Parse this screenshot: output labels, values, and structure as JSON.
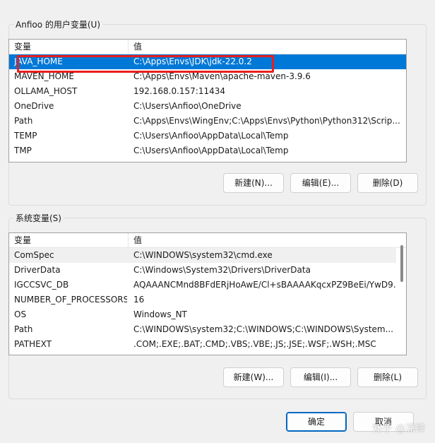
{
  "user_vars": {
    "title": "Anfioo 的用户变量(U)",
    "col_variable": "变量",
    "col_value": "值",
    "rows": [
      {
        "name": "JAVA_HOME",
        "value": "C:\\Apps\\Envs\\JDK\\jdk-22.0.2"
      },
      {
        "name": "MAVEN_HOME",
        "value": "C:\\Apps\\Envs\\Maven\\apache-maven-3.9.6"
      },
      {
        "name": "OLLAMA_HOST",
        "value": "192.168.0.157:11434"
      },
      {
        "name": "OneDrive",
        "value": "C:\\Users\\Anfioo\\OneDrive"
      },
      {
        "name": "Path",
        "value": "C:\\Apps\\Envs\\WingEnv;C:\\Apps\\Envs\\Python\\Python312\\Scrip..."
      },
      {
        "name": "TEMP",
        "value": "C:\\Users\\Anfioo\\AppData\\Local\\Temp"
      },
      {
        "name": "TMP",
        "value": "C:\\Users\\Anfioo\\AppData\\Local\\Temp"
      }
    ],
    "new_label": "新建(N)...",
    "edit_label": "编辑(E)...",
    "delete_label": "删除(D)"
  },
  "system_vars": {
    "title": "系统变量(S)",
    "col_variable": "变量",
    "col_value": "值",
    "rows": [
      {
        "name": "ComSpec",
        "value": "C:\\WINDOWS\\system32\\cmd.exe"
      },
      {
        "name": "DriverData",
        "value": "C:\\Windows\\System32\\Drivers\\DriverData"
      },
      {
        "name": "IGCCSVC_DB",
        "value": "AQAAANCMnd8BFdERjHoAwE/Cl+sBAAAAKqcxPZ9BeEi/YwD9..."
      },
      {
        "name": "NUMBER_OF_PROCESSORS",
        "value": "16"
      },
      {
        "name": "OS",
        "value": "Windows_NT"
      },
      {
        "name": "Path",
        "value": "C:\\WINDOWS\\system32;C:\\WINDOWS;C:\\WINDOWS\\System..."
      },
      {
        "name": "PATHEXT",
        "value": ".COM;.EXE;.BAT;.CMD;.VBS;.VBE;.JS;.JSE;.WSF;.WSH;.MSC"
      }
    ],
    "new_label": "新建(W)...",
    "edit_label": "编辑(I)...",
    "delete_label": "删除(L)"
  },
  "footer": {
    "ok_label": "确定",
    "cancel_label": "取消"
  },
  "watermark": "知乎 @凉肆",
  "colors": {
    "selection": "#0078d7",
    "highlight_box": "#e81f1f",
    "primary_border": "#0067c0"
  }
}
